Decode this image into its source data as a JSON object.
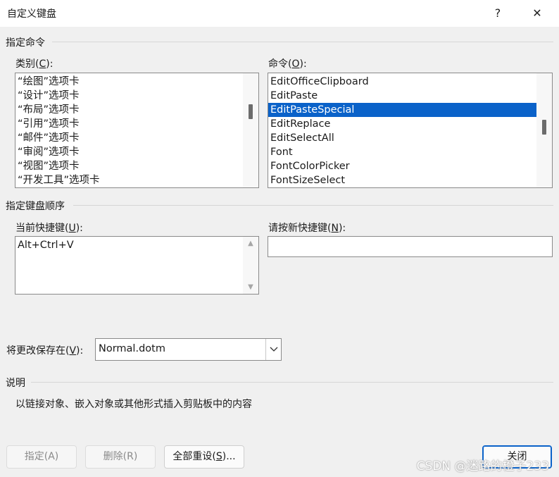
{
  "window": {
    "title": "自定义键盘",
    "help_glyph": "?",
    "close_glyph": "✕"
  },
  "specify_command": {
    "group_label": "指定命令",
    "categories_label": "类别(",
    "categories_key": "C",
    "categories_suffix": "):",
    "categories": [
      "“绘图”选项卡",
      "“设计”选项卡",
      "“布局”选项卡",
      "“引用”选项卡",
      "“邮件”选项卡",
      "“审阅”选项卡",
      "“视图”选项卡",
      "“开发工具”选项卡"
    ],
    "commands_label": "命令(",
    "commands_key": "O",
    "commands_suffix": "):",
    "commands": [
      "EditOfficeClipboard",
      "EditPaste",
      "EditPasteSpecial",
      "EditReplace",
      "EditSelectAll",
      "Font",
      "FontColorPicker",
      "FontSizeSelect"
    ],
    "selected_command_index": 2
  },
  "keyboard_sequence": {
    "group_label": "指定键盘顺序",
    "current_label": "当前快捷键(",
    "current_key": "U",
    "current_suffix": "):",
    "current_keys": [
      "Alt+Ctrl+V"
    ],
    "new_label": "请按新快捷键(",
    "new_key": "N",
    "new_suffix": "):",
    "new_value": ""
  },
  "save_in": {
    "label": "将更改保存在(",
    "key": "V",
    "suffix": "):",
    "value": "Normal.dotm"
  },
  "description": {
    "group_label": "说明",
    "text": "以链接对象、嵌入对象或其他形式插入剪贴板中的内容"
  },
  "buttons": {
    "assign": "指定(A)",
    "remove": "删除(R)",
    "reset_all_prefix": "全部重设(",
    "reset_all_key": "S",
    "reset_all_suffix": ")...",
    "close": "关闭"
  },
  "watermark": "CSDN @迷路的橙子233",
  "colors": {
    "selection": "#0a62c9",
    "dialog_bg": "#f0f0f0"
  }
}
